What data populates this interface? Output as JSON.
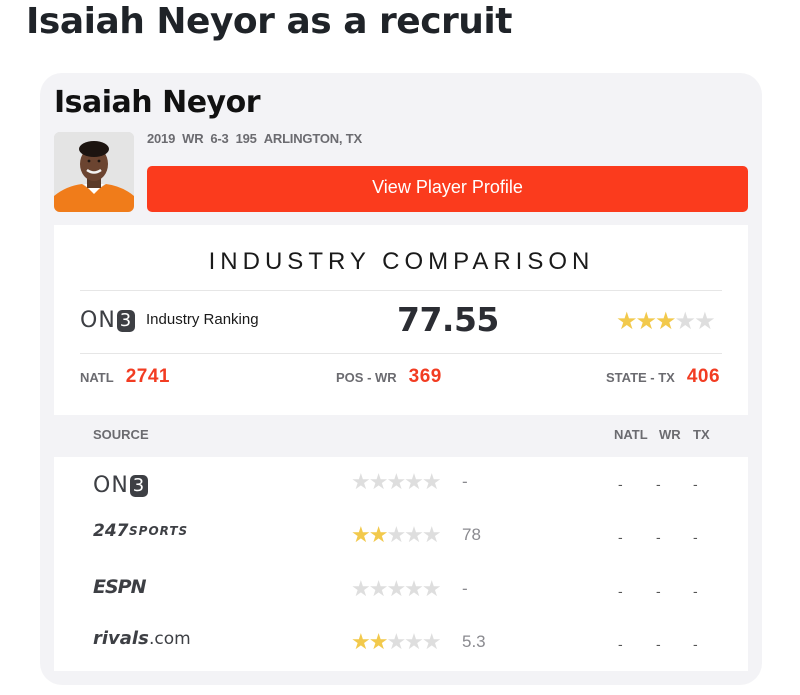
{
  "page": {
    "heading": "Isaiah Neyor as a recruit"
  },
  "player": {
    "name": "Isaiah Neyor",
    "year": "2019",
    "position": "WR",
    "height": "6-3",
    "weight": "195",
    "hometown": "ARLINGTON, TX",
    "avatar_icon": "player-headshot"
  },
  "profile_button": {
    "label": "View Player Profile"
  },
  "industry": {
    "title": "INDUSTRY COMPARISON",
    "brand_logo": "On3",
    "label": "Industry Ranking",
    "score": "77.55",
    "stars": 3,
    "natl_label": "NATL",
    "natl_value": "2741",
    "pos_label": "POS - WR",
    "pos_value": "369",
    "state_label": "STATE - TX",
    "state_value": "406"
  },
  "sources": {
    "headers": {
      "source": "SOURCE",
      "natl": "NATL",
      "pos": "WR",
      "state": "TX"
    },
    "rows": [
      {
        "logo": "On3",
        "stars": 0,
        "rating": "-",
        "natl": "-",
        "pos": "-",
        "state": "-"
      },
      {
        "logo": "247Sports",
        "stars": 2,
        "rating": "78",
        "natl": "-",
        "pos": "-",
        "state": "-"
      },
      {
        "logo": "ESPN",
        "stars": 0,
        "rating": "-",
        "natl": "-",
        "pos": "-",
        "state": "-"
      },
      {
        "logo": "rivals.com",
        "stars": 2,
        "rating": "5.3",
        "natl": "-",
        "pos": "-",
        "state": "-"
      }
    ]
  },
  "colors": {
    "accent": "#fb3b1d",
    "rank_red": "#f23c22",
    "star_on": "#f2c94c",
    "star_off": "#dedede"
  }
}
